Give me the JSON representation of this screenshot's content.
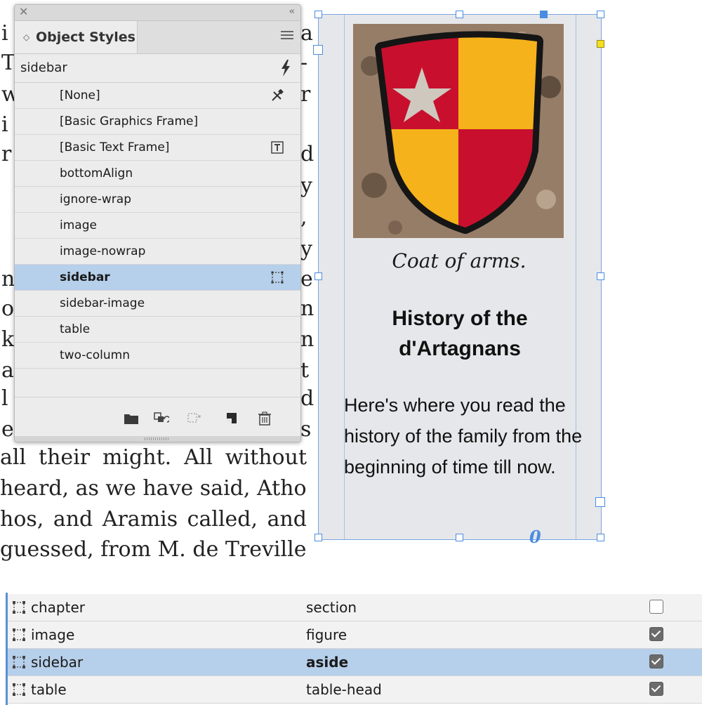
{
  "document": {
    "lines": [
      "all their might. All without",
      "heard, as we have said, Athos,",
      "hos, and Aramis called, and",
      "guessed, from M. de Treville’s"
    ],
    "left_edge_chars": [
      "i",
      "T",
      "w",
      "i",
      "r",
      "",
      "",
      "n",
      "o",
      "k",
      "a",
      "l",
      "e"
    ],
    "right_edge_chars": [
      "a",
      "-",
      "r",
      "",
      "d",
      "y",
      ",",
      "y",
      "e",
      "n",
      "n",
      "t",
      "d",
      "s"
    ]
  },
  "object_styles_panel": {
    "title": "Object Styles",
    "current_style": "sidebar",
    "styles": [
      {
        "label": "[None]",
        "icon": "eraser-icon"
      },
      {
        "label": "[Basic Graphics Frame]",
        "icon": ""
      },
      {
        "label": "[Basic Text Frame]",
        "icon": "text-frame-icon"
      },
      {
        "label": "bottomAlign",
        "icon": ""
      },
      {
        "label": "ignore-wrap",
        "icon": ""
      },
      {
        "label": "image",
        "icon": ""
      },
      {
        "label": "image-nowrap",
        "icon": ""
      },
      {
        "label": "sidebar",
        "icon": "frame-icon",
        "selected": true
      },
      {
        "label": "sidebar-image",
        "icon": ""
      },
      {
        "label": "table",
        "icon": ""
      },
      {
        "label": "two-column",
        "icon": ""
      }
    ],
    "footer_icons": [
      "folder-icon",
      "apply-style-icon",
      "clear-overrides-icon",
      "new-style-icon",
      "trash-icon"
    ]
  },
  "sidebar": {
    "caption": "Coat of arms.",
    "heading": "History of the d'Artagnans",
    "body": "Here's where you read the history of the family from the beginning of time till now.",
    "overset_marker": "0",
    "shield_colors": {
      "red": "#c8102e",
      "yellow": "#f5b21b",
      "outline": "#151515",
      "star": "#cfc8be"
    }
  },
  "export_tags": {
    "rows": [
      {
        "style": "chapter",
        "tag": "section",
        "checked": false
      },
      {
        "style": "image",
        "tag": "figure",
        "checked": true
      },
      {
        "style": "sidebar",
        "tag": "aside",
        "checked": true,
        "selected": true
      },
      {
        "style": "table",
        "tag": "table-head",
        "checked": true
      }
    ]
  },
  "colors": {
    "selection": "#b6cfea",
    "frame_edge": "#4a8de0"
  }
}
